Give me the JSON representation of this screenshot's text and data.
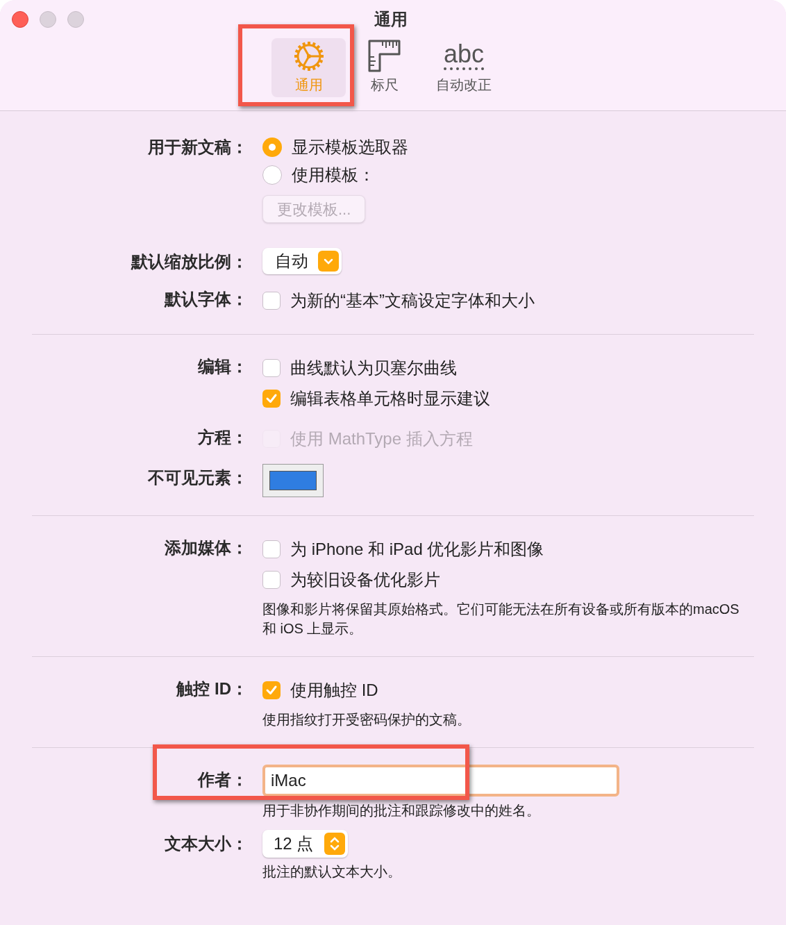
{
  "window": {
    "title": "通用"
  },
  "toolbar": [
    {
      "kind": "gear",
      "label": "通用",
      "selected": true
    },
    {
      "kind": "ruler",
      "label": "标尺",
      "selected": false
    },
    {
      "kind": "abc",
      "icon_text": "abc",
      "label": "自动改正",
      "selected": false
    }
  ],
  "sections": [
    [
      {
        "label": "用于新文稿：",
        "controls": [
          {
            "kind": "radio",
            "text": "显示模板选取器",
            "selected": true
          },
          {
            "kind": "radio",
            "text": "使用模板：",
            "selected": false
          },
          {
            "kind": "button",
            "text": "更改模板...",
            "disabled": true
          }
        ]
      },
      {
        "label": "默认缩放比例：",
        "controls": [
          {
            "kind": "popup",
            "value": "自动"
          }
        ]
      },
      {
        "label": "默认字体：",
        "controls": [
          {
            "kind": "checkbox",
            "text": "为新的“基本”文稿设定字体和大小",
            "checked": false,
            "disabled": false
          }
        ]
      }
    ],
    [
      {
        "label": "编辑：",
        "controls": [
          {
            "kind": "checkbox",
            "text": "曲线默认为贝塞尔曲线",
            "checked": false,
            "disabled": false
          },
          {
            "kind": "checkbox",
            "text": "编辑表格单元格时显示建议",
            "checked": true,
            "disabled": false
          }
        ]
      },
      {
        "label": "方程：",
        "controls": [
          {
            "kind": "checkbox",
            "text": "使用 MathType 插入方程",
            "checked": false,
            "disabled": true
          }
        ]
      },
      {
        "label": "不可见元素：",
        "controls": [
          {
            "kind": "color_well",
            "color": "#2f7de1"
          }
        ]
      }
    ],
    [
      {
        "label": "添加媒体：",
        "controls": [
          {
            "kind": "checkbox",
            "text": "为 iPhone 和 iPad 优化影片和图像",
            "checked": false,
            "disabled": false
          },
          {
            "kind": "checkbox",
            "text": "为较旧设备优化影片",
            "checked": false,
            "disabled": false
          },
          {
            "kind": "note",
            "text": "图像和影片将保留其原始格式。它们可能无法在所有设备或所有版本的macOS 和 iOS 上显示。"
          }
        ]
      }
    ],
    [
      {
        "label": "触控 ID：",
        "controls": [
          {
            "kind": "checkbox",
            "text": "使用触控 ID",
            "checked": true,
            "disabled": false
          },
          {
            "kind": "note",
            "text": "使用指纹打开受密码保护的文稿。"
          }
        ]
      }
    ],
    [
      {
        "label": "作者：",
        "controls": [
          {
            "kind": "text_field",
            "value": "iMac",
            "focused": true
          },
          {
            "kind": "note",
            "text": "用于非协作期间的批注和跟踪修改中的姓名。"
          }
        ]
      },
      {
        "label": "文本大小：",
        "controls": [
          {
            "kind": "stepper",
            "value": "12 点"
          },
          {
            "kind": "note",
            "text": "批注的默认文本大小。"
          }
        ]
      }
    ]
  ]
}
